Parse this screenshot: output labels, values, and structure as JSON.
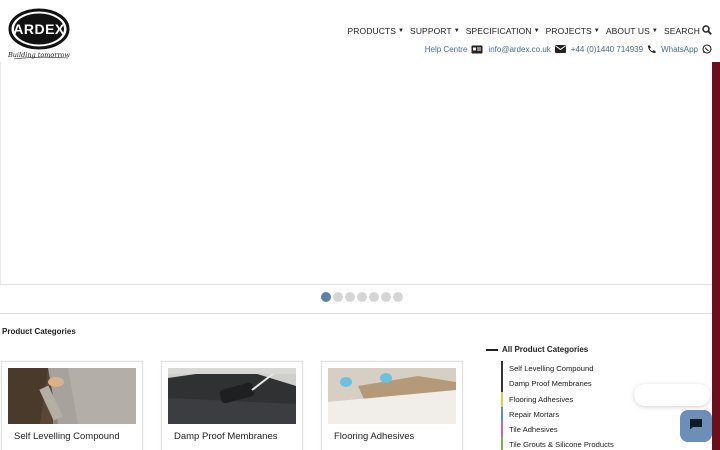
{
  "brand": {
    "name": "ARDEX",
    "tagline": "Building tomorrow"
  },
  "nav": {
    "items": [
      {
        "label": "PRODUCTS",
        "has_dropdown": true
      },
      {
        "label": "SUPPORT",
        "has_dropdown": true
      },
      {
        "label": "SPECIFICATION",
        "has_dropdown": true
      },
      {
        "label": "PROJECTS",
        "has_dropdown": true
      },
      {
        "label": "ABOUT US",
        "has_dropdown": true
      },
      {
        "label": "SEARCH",
        "has_dropdown": false
      }
    ],
    "search_icon": "search-icon"
  },
  "contact": {
    "help_label": "Help Centre",
    "help_icon": "id-card-icon",
    "email_label": "info@ardex.co.uk",
    "email_icon": "envelope-icon",
    "phone_label": "+44 (0)1440 714939",
    "phone_icon": "phone-icon",
    "whatsapp_label": "WhatsApp",
    "whatsapp_icon": "whatsapp-icon"
  },
  "carousel": {
    "slide_count": 7,
    "active_index": 0
  },
  "product_categories": {
    "heading": "Product Categories",
    "cards": [
      {
        "title": "Self Levelling Compound"
      },
      {
        "title": "Damp Proof Membranes"
      },
      {
        "title": "Flooring Adhesives"
      }
    ],
    "all_label": "All Product Categories",
    "list": [
      {
        "label": "Self Levelling Compound",
        "color": "#333333"
      },
      {
        "label": "Damp Proof Membranes",
        "color": "#333333"
      },
      {
        "label": "Flooring Adhesives",
        "color": "#e8c64a"
      },
      {
        "label": "Repair Mortars",
        "color": "#5a8fcf"
      },
      {
        "label": "Tile Adhesives",
        "color": "#c86aa8"
      },
      {
        "label": "Tile Grouts & Silicone Products",
        "color": "#7fb24a"
      }
    ]
  },
  "colors": {
    "accent_blue": "#5d80aa",
    "link_blue": "#4a6b96",
    "edge_strip": "#6b0f1a",
    "chat_button": "#6d8fb7"
  },
  "chat": {
    "icon": "chat-bubble-icon"
  }
}
